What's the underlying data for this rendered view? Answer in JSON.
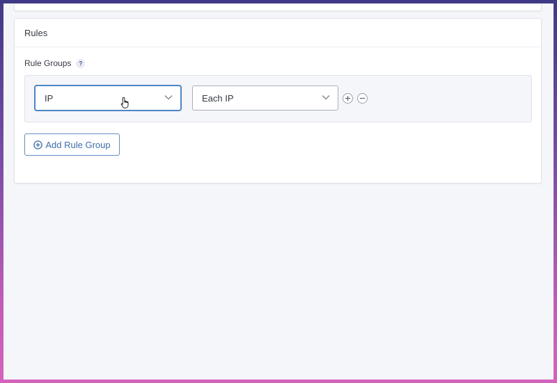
{
  "rules_panel": {
    "title": "Rules",
    "rule_groups_label": "Rule Groups",
    "help_badge": "?",
    "rule_group": {
      "condition_select_value": "IP",
      "scope_select_value": "Each IP"
    },
    "add_rule_group_label": "Add Rule Group"
  },
  "icons": {
    "help": "question-icon",
    "chevron": "chevron-down-icon",
    "add": "plus-circle-icon",
    "remove": "minus-circle-icon",
    "cursor": "hand-pointer-icon"
  },
  "colors": {
    "accent_blue": "#4c84c4",
    "button_text": "#3e6ea8",
    "panel_background": "#f5f6fa"
  }
}
